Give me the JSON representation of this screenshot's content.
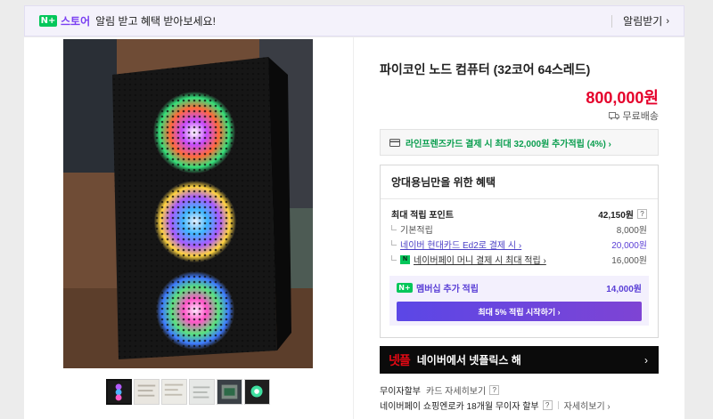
{
  "topbar": {
    "logo_n": "N+",
    "logo_text": "스토어",
    "message": "알림 받고 혜택 받아보세요!",
    "alarm_button": "알림받기",
    "chevron": "›"
  },
  "product": {
    "title": "파이코인 노드 컴퓨터 (32코어 64스레드)",
    "price": "800,000원",
    "shipping": "무료배송",
    "shipping_icon": "truck-icon"
  },
  "card_banner": {
    "icon": "card-icon",
    "text": "라인프렌즈카드 결제 시 최대 32,000원 추가적립 (4%) ›"
  },
  "benefit": {
    "heading": "앙대용님만을 위한 혜택",
    "max_label": "최대 적립 포인트",
    "max_value": "42,150원",
    "qmark": "?",
    "rows": [
      {
        "label": "기본적립",
        "value": "8,000원"
      },
      {
        "label": "네이버 현대카드 Ed2로 결제 시 ›",
        "value": "20,000원"
      },
      {
        "label": "네이버페이 머니 결제 시 최대 적립 ›",
        "value": "16,000원"
      }
    ],
    "npay_badge": "N",
    "member_badge": "N+",
    "member_label": "멤버십 추가 적립",
    "member_value": "14,000원",
    "member_button": "최대 5% 적립 시작하기 ›"
  },
  "netflix": {
    "logo": "넷플",
    "text": "네이버에서 넷플릭스 해",
    "chevron": "›"
  },
  "installment": {
    "label": "무이자할부",
    "link": "카드 자세히보기",
    "qmark": "?"
  },
  "payline": {
    "text": "네이버페이 쇼핑엔로카 18개월 무이자 할부",
    "qmark": "?",
    "link": "자세히보기 ›"
  },
  "colors": {
    "price_red": "#e5002b",
    "naver_green": "#03c75a",
    "brand_purple": "#7a3ff2"
  }
}
